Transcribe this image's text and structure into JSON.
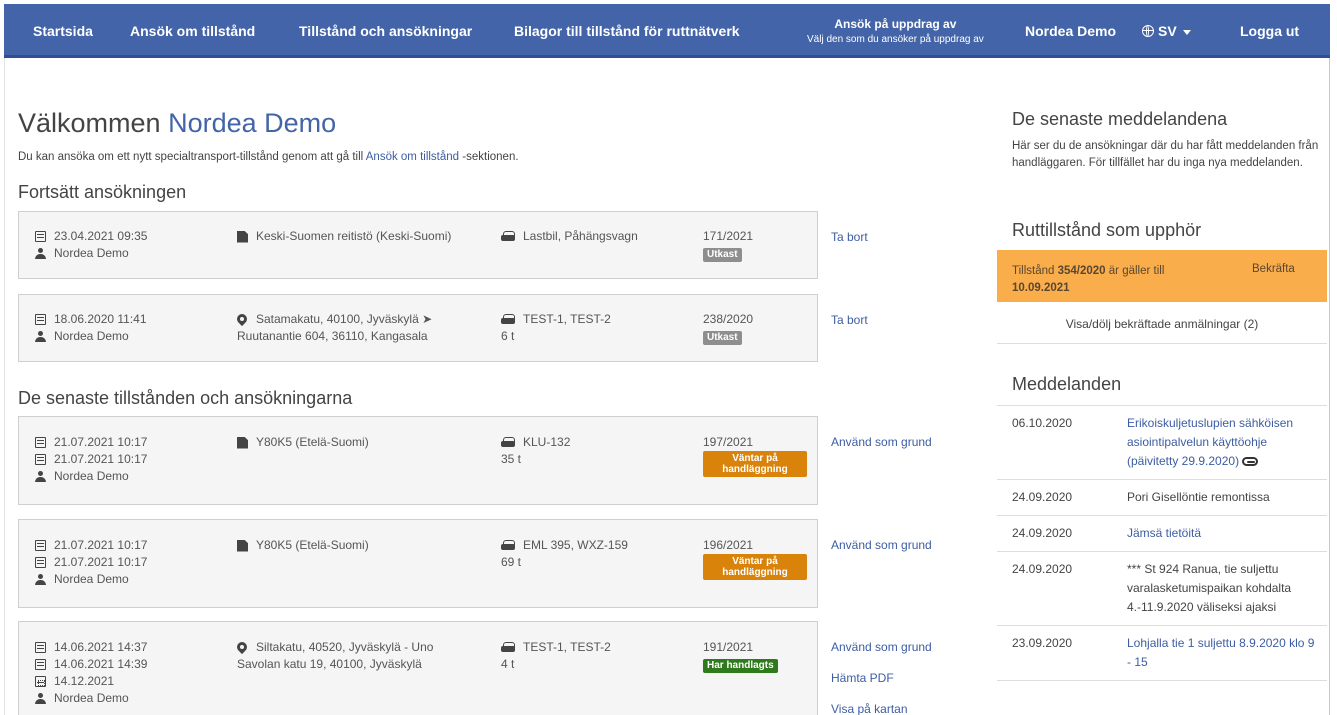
{
  "nav": {
    "home": "Startsida",
    "apply": "Ansök om tillstånd",
    "permits": "Tillstånd och ansökningar",
    "attachments": "Bilagor till tillstånd för ruttnätverk",
    "on_behalf_title": "Ansök på uppdrag av",
    "on_behalf_sub": "Välj den som du ansöker på uppdrag av",
    "user": "Nordea Demo",
    "language": "SV",
    "logout": "Logga ut"
  },
  "welcome": {
    "prefix": "Välkommen",
    "name": "Nordea Demo",
    "intro_before": "Du kan ansöka om ett nytt specialtransport-tillstånd genom att gå till",
    "intro_link": "Ansök om tillstånd",
    "intro_after": "-sektionen."
  },
  "continue_title": "Fortsätt ansökningen",
  "drafts": [
    {
      "date1": "23.04.2021 09:35",
      "user": "Nordea Demo",
      "route": "Keski-Suomen reitistö (Keski-Suomi)",
      "vehicle": "Lastbil, Påhängsvagn",
      "number": "171/2021",
      "status": "Utkast",
      "action": "Ta bort"
    },
    {
      "date1": "18.06.2020 11:41",
      "user": "Nordea Demo",
      "route1": "Satamakatu, 40100, Jyväskylä ➤",
      "route2": "Ruutanantie 604, 36110, Kangasala",
      "vehicle": "TEST-1, TEST-2",
      "weight": "6 t",
      "number": "238/2020",
      "status": "Utkast",
      "action": "Ta bort"
    }
  ],
  "recent_title": "De senaste tillstånden och ansökningarna",
  "recent": [
    {
      "date1": "21.07.2021 10:17",
      "date2": "21.07.2021 10:17",
      "user": "Nordea Demo",
      "route": "Y80K5 (Etelä-Suomi)",
      "vehicle": "KLU-132",
      "weight": "35 t",
      "number": "197/2021",
      "status_line1": "Väntar på",
      "status_line2": "handläggning",
      "action": "Använd som grund"
    },
    {
      "date1": "21.07.2021 10:17",
      "date2": "21.07.2021 10:17",
      "user": "Nordea Demo",
      "route": "Y80K5 (Etelä-Suomi)",
      "vehicle": "EML 395, WXZ-159",
      "weight": "69 t",
      "number": "196/2021",
      "status_line1": "Väntar på",
      "status_line2": "handläggning",
      "action": "Använd som grund"
    },
    {
      "date1": "14.06.2021 14:37",
      "date2": "14.06.2021 14:39",
      "date3": "14.12.2021",
      "user": "Nordea Demo",
      "route1": "Siltakatu, 40520, Jyväskylä - Uno",
      "route2": "Savolan katu 19, 40100, Jyväskylä",
      "vehicle": "TEST-1, TEST-2",
      "weight": "4 t",
      "number": "191/2021",
      "status": "Har handlagts",
      "action": "Använd som grund",
      "action2": "Hämta PDF",
      "action3": "Visa på kartan"
    }
  ],
  "sidebar": {
    "latest_title": "De senaste meddelandena",
    "latest_text": "Här ser du de ansökningar där du har fått meddelanden från handläggaren. För tillfället har du inga nya meddelanden.",
    "expiring_title": "Ruttillstånd som upphör",
    "expiring_prefix": "Tillstånd",
    "expiring_permit": "354/2020",
    "expiring_mid": "är gäller till",
    "expiring_date": "10.09.2021",
    "expiring_confirm": "Bekräfta",
    "toggle_confirmed": "Visa/dölj bekräftade anmälningar (2)",
    "messages_title": "Meddelanden",
    "messages": [
      {
        "date": "06.10.2020",
        "text": "Erikoiskuljetuslupien sähköisen asiointipalvelun käyttöohje (päivitetty 29.9.2020)",
        "link": true,
        "attachment": true
      },
      {
        "date": "24.09.2020",
        "text": "Pori Gisellöntie remontissa",
        "link": false,
        "attachment": false
      },
      {
        "date": "24.09.2020",
        "text": "Jämsä tietöitä",
        "link": true,
        "attachment": false
      },
      {
        "date": "24.09.2020",
        "text": "*** St 924 Ranua, tie suljettu varalasketumispaikan kohdalta 4.-11.9.2020 väliseksi ajaksi",
        "link": false,
        "attachment": false
      },
      {
        "date": "23.09.2020",
        "text": "Lohjalla tie 1 suljettu 8.9.2020 klo 9 - 15",
        "link": true,
        "attachment": false
      }
    ]
  },
  "colors": {
    "nav": "#4364a8",
    "link": "#3d5da2",
    "draft_badge": "#8e8e8e",
    "pending_badge": "#d9830b",
    "done_badge": "#2f7a1d",
    "expiry_bg": "#f9ad4b"
  },
  "icons": [
    "calendar-icon",
    "user-icon",
    "document-icon",
    "location-pin-icon",
    "car-icon",
    "calendar-outline-icon",
    "attachment-icon",
    "globe-icon",
    "caret-down-icon"
  ]
}
